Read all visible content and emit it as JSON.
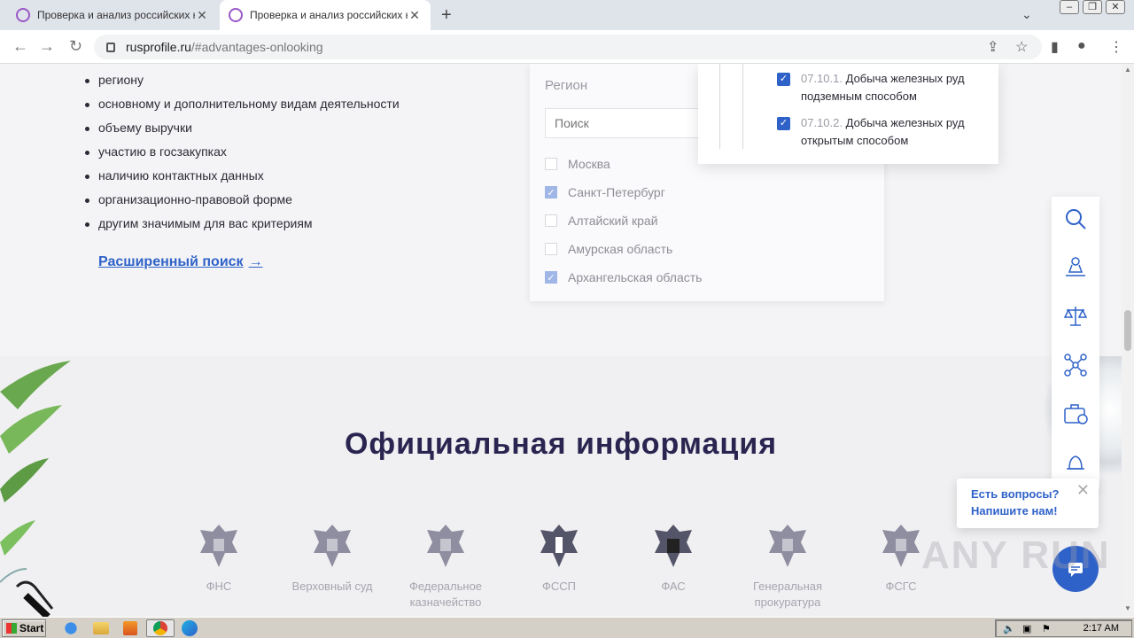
{
  "browser": {
    "tabs": [
      {
        "title": "Проверка и анализ российских юр",
        "active": false
      },
      {
        "title": "Проверка и анализ российских юр",
        "active": true
      }
    ],
    "new_tab": "+",
    "close": "✕",
    "url_host": "rusprofile.ru",
    "url_path": "/#advantages-onlooking"
  },
  "filters": {
    "items": [
      "региону",
      "основному и дополнительному видам деятельности",
      "объему выручки",
      "участию в госзакупках",
      "наличию контактных данных",
      "организационно-правовой форме",
      "другим значимым для вас критериям"
    ],
    "advanced_link": "Расширенный поиск",
    "advanced_arrow": "→"
  },
  "region_panel": {
    "title": "Регион",
    "search_placeholder": "Поиск",
    "regions": [
      {
        "name": "Москва",
        "checked": false
      },
      {
        "name": "Санкт-Петербург",
        "checked": true
      },
      {
        "name": "Алтайский край",
        "checked": false
      },
      {
        "name": "Амурская область",
        "checked": false
      },
      {
        "name": "Архангельская область",
        "checked": true
      }
    ]
  },
  "okved_popup": {
    "items": [
      {
        "code": "07.10.1.",
        "text": "Добыча железных руд подземным способом",
        "checked": true
      },
      {
        "code": "07.10.2.",
        "text": "Добыча железных руд открытым способом",
        "checked": true
      }
    ]
  },
  "official": {
    "title": "Официальная информация",
    "orgs": [
      "ФНС",
      "Верховный суд",
      "Федеральное казначейство",
      "ФССП",
      "ФАС",
      "Генеральная прокуратура",
      "ФСГС"
    ]
  },
  "sidebar": {
    "icons": [
      "search-icon",
      "stamp-icon",
      "scales-icon",
      "network-icon",
      "briefcase-icon",
      "bell-icon"
    ]
  },
  "chat": {
    "line1": "Есть вопросы?",
    "line2": "Напишите нам!",
    "close": "✕"
  },
  "watermark": "ANY RUN",
  "taskbar": {
    "start": "Start",
    "clock": "2:17 AM"
  },
  "colors": {
    "accent": "#2f62c8",
    "title": "#2a2550"
  }
}
